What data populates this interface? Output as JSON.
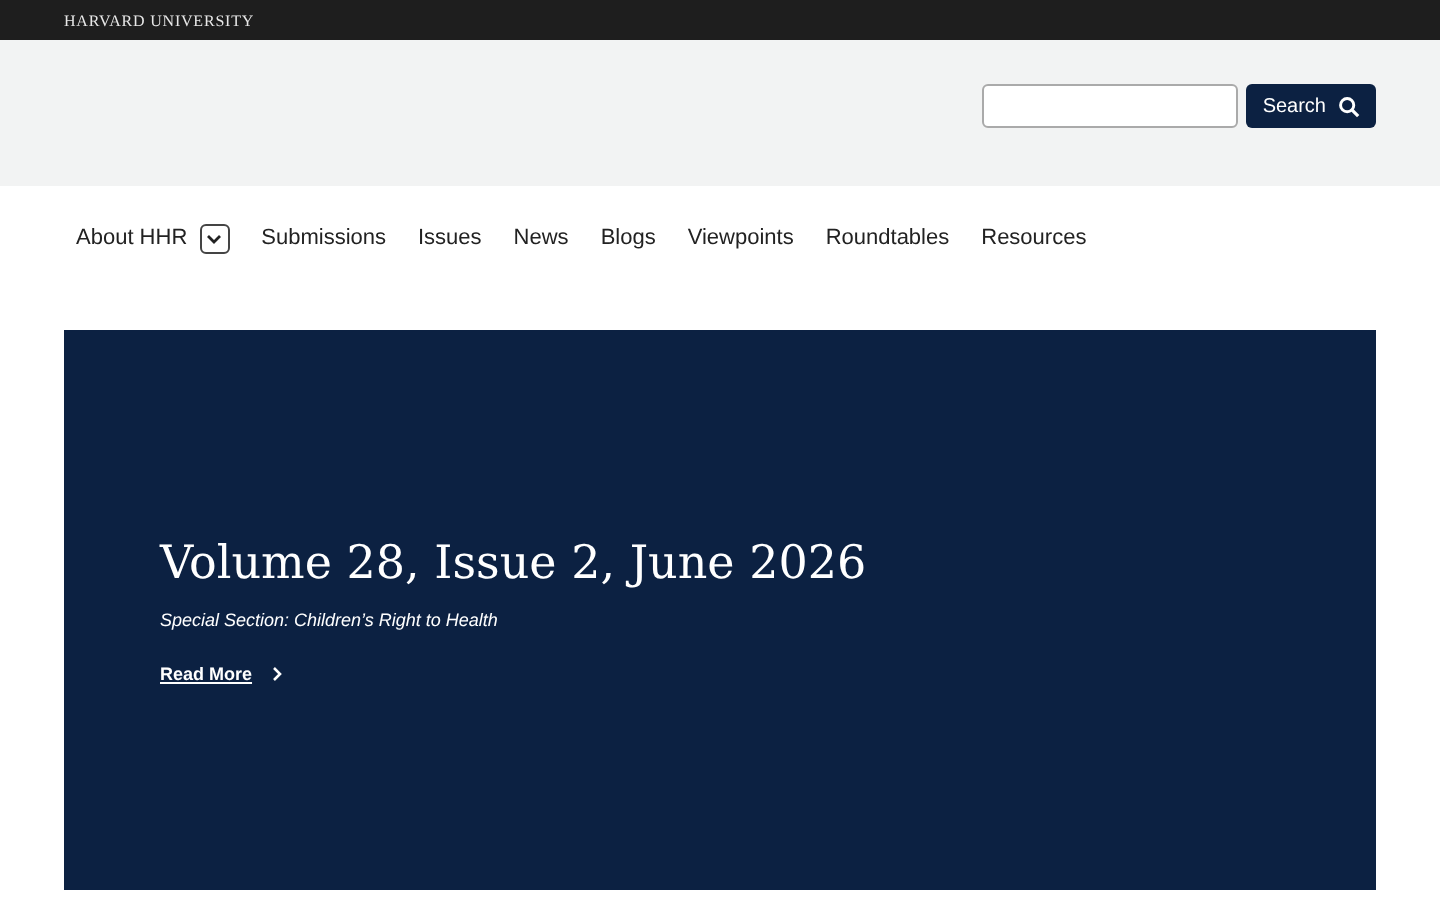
{
  "topbar": {
    "brand": "HARVARD UNIVERSITY"
  },
  "search": {
    "button": "Search"
  },
  "nav": [
    {
      "label": "About HHR",
      "kind": "dropdown"
    },
    {
      "label": "Submissions",
      "kind": "link"
    },
    {
      "label": "Issues",
      "kind": "link"
    },
    {
      "label": "News",
      "kind": "link"
    },
    {
      "label": "Blogs",
      "kind": "link"
    },
    {
      "label": "Viewpoints",
      "kind": "link"
    },
    {
      "label": "Roundtables",
      "kind": "link"
    },
    {
      "label": "Resources",
      "kind": "link"
    }
  ],
  "hero": {
    "title": "Volume 28, Issue 2, June 2026",
    "subtitle": "Special Section: Children’s Right to Health",
    "link": "Read More"
  }
}
